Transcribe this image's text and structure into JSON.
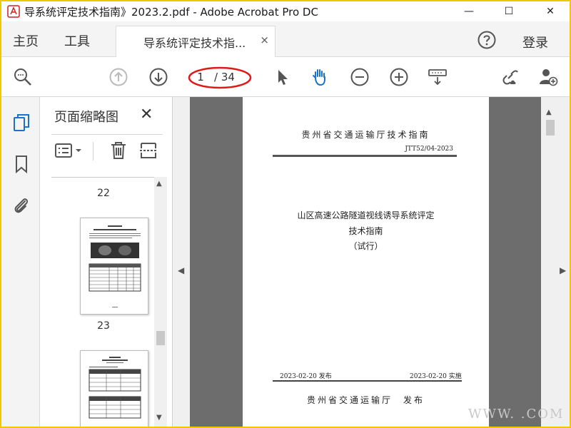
{
  "window": {
    "title": "导系统评定技术指南》2023.2.pdf - Adobe Acrobat Pro DC",
    "minimize": "—",
    "maximize": "☐",
    "close": "✕"
  },
  "tabs": {
    "home": "主页",
    "tools": "工具",
    "document": "导系统评定技术指...",
    "document_close": "×",
    "login": "登录"
  },
  "toolbar": {
    "current_page": "1",
    "total_pages": "/ 34",
    "highlight_color": "#e01818",
    "accent_color": "#1a73c8"
  },
  "thumbnail_panel": {
    "title": "页面缩略图",
    "close": "✕",
    "pages": [
      {
        "label": "22"
      },
      {
        "label": "23"
      }
    ]
  },
  "document_page": {
    "header": "贵州省交通运输厅技术指南",
    "code": "JTT52/04-2023",
    "title_line1": "山区高速公路隧道视线诱导系统评定",
    "title_line2": "技术指南",
    "title_line3": "（试行）",
    "publish_date": "2023-02-20 发布",
    "effective_date": "2023-02-20 实施",
    "footer": "贵州省交通运输厅　发布"
  },
  "watermark": {
    "text": "WWW.  .COM"
  }
}
